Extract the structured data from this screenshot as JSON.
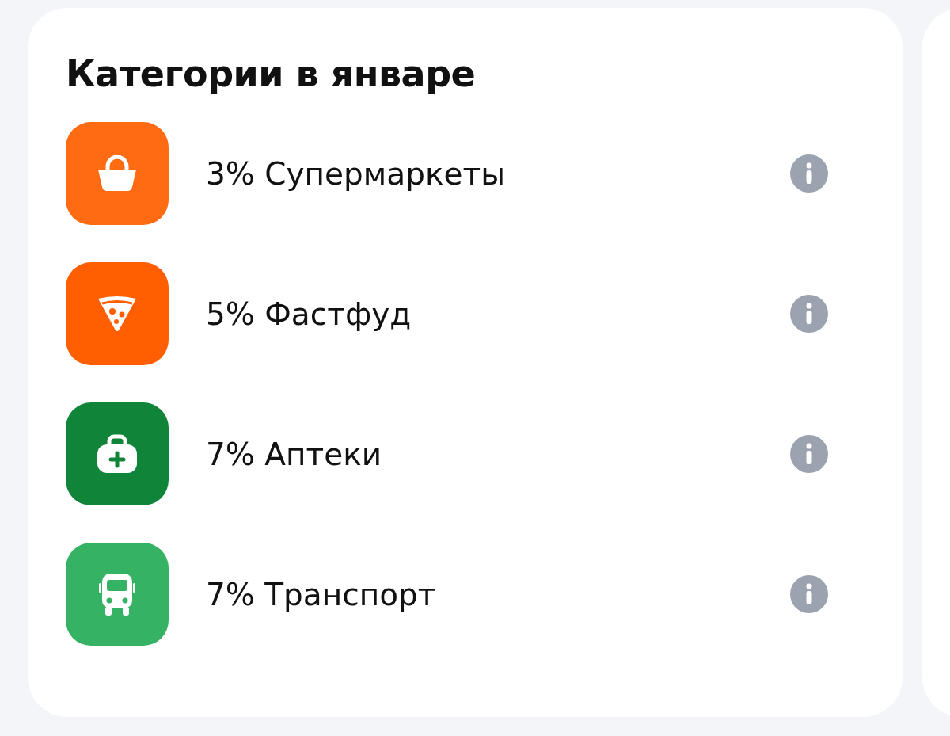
{
  "title": "Категории в январе",
  "categories": [
    {
      "kind": "basket",
      "color": "#ff6b12",
      "label": "3% Супермаркеты"
    },
    {
      "kind": "pizza",
      "color": "#ff5f00",
      "label": "5% Фастфуд"
    },
    {
      "kind": "medkit",
      "color": "#10853a",
      "label": "7% Аптеки"
    },
    {
      "kind": "bus",
      "color": "#35b263",
      "label": "7% Транспорт"
    }
  ]
}
